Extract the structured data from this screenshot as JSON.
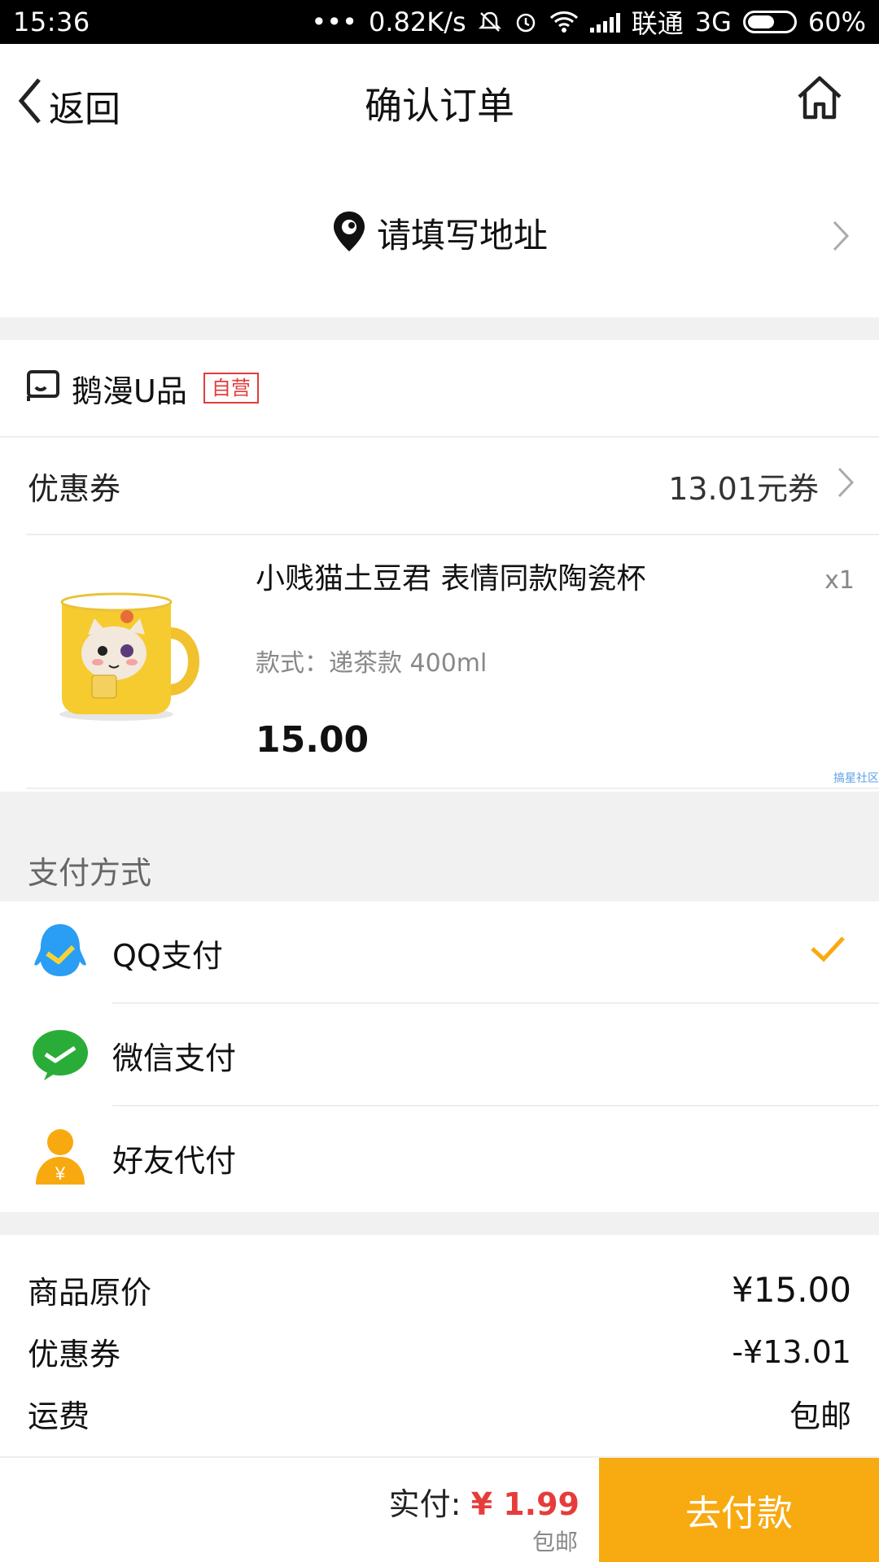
{
  "status_bar": {
    "time": "15:36",
    "dots": "•••",
    "speed": "0.82K/s",
    "carrier": "联通",
    "network": "3G",
    "battery": "60%",
    "battery_level": 0.6
  },
  "header": {
    "back_label": "返回",
    "title": "确认订单",
    "home_icon": "home-icon"
  },
  "address": {
    "label": "请填写地址",
    "icon": "location-pin-icon"
  },
  "shop": {
    "name": "鹅漫U品",
    "badge": "自营"
  },
  "coupon": {
    "label": "优惠券",
    "value": "13.01元券"
  },
  "product": {
    "name": "小贱猫土豆君 表情同款陶瓷杯",
    "spec": "款式：递茶款 400ml",
    "quantity": "x1",
    "price": "15.00",
    "watermark": "搞星社区"
  },
  "payment": {
    "section_label": "支付方式",
    "options": [
      {
        "label": "QQ支付",
        "icon": "qq-penguin-icon",
        "selected": true
      },
      {
        "label": "微信支付",
        "icon": "wechat-icon",
        "selected": false
      },
      {
        "label": "好友代付",
        "icon": "friend-pay-icon",
        "selected": false
      }
    ],
    "accent_color": "#f8aa11"
  },
  "summary": {
    "original_label": "商品原价",
    "original_value": "¥15.00",
    "coupon_label": "优惠券",
    "coupon_value": "-¥13.01",
    "shipping_label": "运费",
    "shipping_value": "包邮"
  },
  "bottom": {
    "total_label": "实付:",
    "total_value": "¥ 1.99",
    "shipping_note": "包邮",
    "pay_button": "去付款"
  }
}
